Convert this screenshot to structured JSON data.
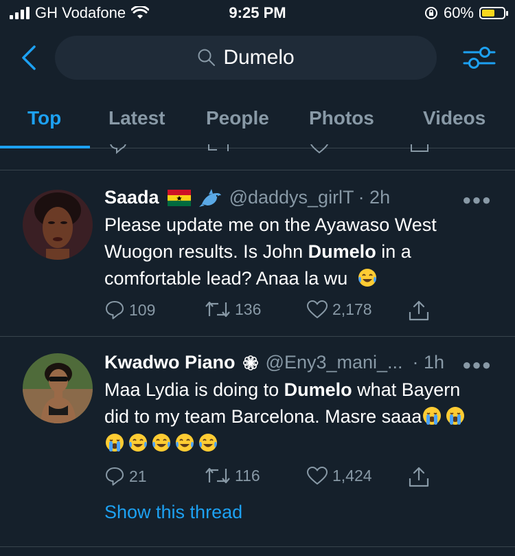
{
  "status_bar": {
    "carrier": "GH Vodafone",
    "time": "9:25 PM",
    "battery": "60%",
    "battery_level": 0.6,
    "colors": {
      "battery_fill": "#f9d71c"
    }
  },
  "search": {
    "query": "Dumelo"
  },
  "tabs": [
    {
      "label": "Top",
      "active": true
    },
    {
      "label": "Latest"
    },
    {
      "label": "People"
    },
    {
      "label": "Photos"
    },
    {
      "label": "Videos"
    }
  ],
  "tweets": [
    {
      "name": "Saada",
      "name_emojis": [
        "ghana-flag",
        "dolphin"
      ],
      "handle": "@daddys_girlT",
      "time": "· 2h",
      "body_parts": [
        "Please update me on the Ayawaso West Wuogon results. Is John ",
        "Dumelo",
        " in a comfortable lead? Anaa la wu"
      ],
      "trailing_emojis": [
        "tears-of-joy"
      ],
      "replies": "109",
      "retweets": "136",
      "likes": "2,178"
    },
    {
      "name": "Kwadwo Piano",
      "name_emojis": [
        "flower"
      ],
      "handle": "@Eny3_mani_...",
      "time": "· 1h",
      "body_parts": [
        "Maa Lydia is doing to ",
        "Dumelo",
        " what Bayern did to my team Barcelona. Masre saaa"
      ],
      "trailing_emojis": [
        "crying",
        "crying",
        "crying",
        "tears-of-joy",
        "tears-of-joy",
        "tears-of-joy",
        "tears-of-joy"
      ],
      "replies": "21",
      "retweets": "116",
      "likes": "1,424",
      "thread_link": "Show this thread"
    }
  ],
  "colors": {
    "background": "#15202b",
    "accent": "#1da1f2",
    "muted": "#8899a6",
    "divider": "#38444d"
  }
}
